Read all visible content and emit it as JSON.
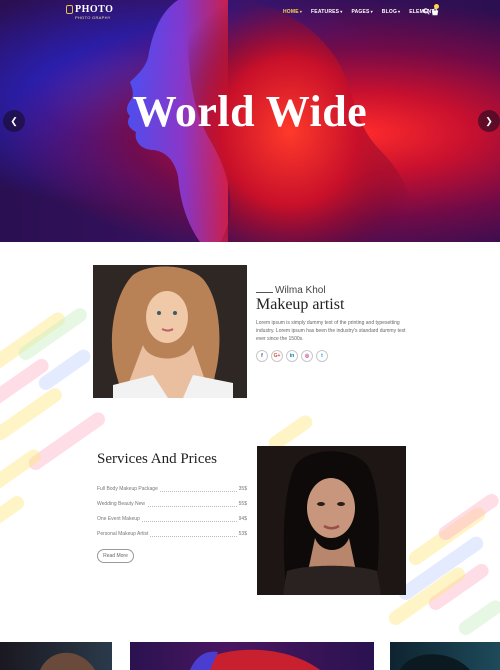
{
  "nav": {
    "logo_title": "PHOTO",
    "logo_subtitle": "PHOTO GRAPHY",
    "menu": [
      {
        "label": "HOME",
        "active": true
      },
      {
        "label": "FEATURES",
        "active": false
      },
      {
        "label": "PAGES",
        "active": false
      },
      {
        "label": "BLOG",
        "active": false
      },
      {
        "label": "ELEMENT",
        "active": false
      }
    ],
    "icons": [
      "search-icon",
      "cart-icon"
    ]
  },
  "hero": {
    "title": "World Wide",
    "prev_icon": "chevron-left-icon",
    "next_icon": "chevron-right-icon"
  },
  "profile": {
    "name": "Wilma Khol",
    "role": "Makeup artist",
    "description": "Lorem ipsum is simply dummy text of the printing and typesetting industry. Lorem ipsum has been the industry's standard dummy text ever since the 1500s.",
    "social": [
      {
        "icon": "facebook-icon",
        "glyph": "f",
        "color": "#3b5998"
      },
      {
        "icon": "google-plus-icon",
        "glyph": "G+",
        "color": "#dd4b39"
      },
      {
        "icon": "linkedin-icon",
        "glyph": "in",
        "color": "#0077b5"
      },
      {
        "icon": "instagram-icon",
        "glyph": "◎",
        "color": "#c13584"
      },
      {
        "icon": "twitter-icon",
        "glyph": "t",
        "color": "#1da1f2"
      }
    ]
  },
  "services": {
    "title": "Services And Prices",
    "items": [
      {
        "name": "Full Body Makeup Package",
        "price": "35$"
      },
      {
        "name": "Wedding Beauty New",
        "price": "55$"
      },
      {
        "name": "One Event Makeup",
        "price": "94$"
      },
      {
        "name": "Personal Makeup Artist",
        "price": "53$"
      }
    ],
    "button": "Read More"
  },
  "colors": {
    "accent": "#ffd84a",
    "stripe_yellow": "#ffe680",
    "stripe_pink": "#ffb3c8",
    "stripe_blue": "#c4d3ff",
    "stripe_green": "#c8f0c0"
  }
}
